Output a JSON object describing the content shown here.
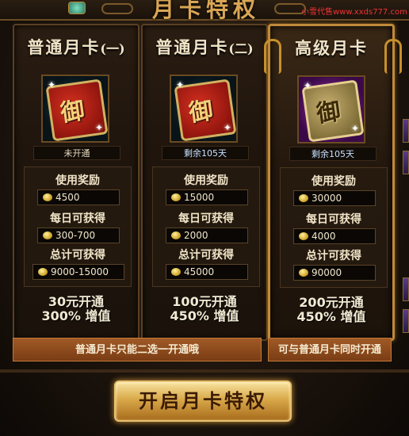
{
  "header": {
    "title": "月卡特权",
    "watermark": "小雪代售www.xxds777.com"
  },
  "cards": [
    {
      "title": "普通月卡",
      "suffix": "(一)",
      "status": "未开通",
      "reward_title": "使用奖励",
      "reward_value": "4500",
      "daily_title": "每日可获得",
      "daily_value": "300-700",
      "total_title": "总计可获得",
      "total_value": "9000-15000",
      "price": "30元开通",
      "bonus": "300% 增值"
    },
    {
      "title": "普通月卡",
      "suffix": "(二)",
      "status": "剩余105天",
      "reward_title": "使用奖励",
      "reward_value": "15000",
      "daily_title": "每日可获得",
      "daily_value": "2000",
      "total_title": "总计可获得",
      "total_value": "45000",
      "price": "100元开通",
      "bonus": "450% 增值"
    },
    {
      "title": "高级月卡",
      "suffix": "",
      "status": "剩余105天",
      "reward_title": "使用奖励",
      "reward_value": "30000",
      "daily_title": "每日可获得",
      "daily_value": "4000",
      "total_title": "总计可获得",
      "total_value": "90000",
      "price": "200元开通",
      "bonus": "450% 增值"
    }
  ],
  "notes": {
    "normal": "普通月卡只能二选一开通哦",
    "premium": "可与普通月卡同时开通"
  },
  "button": {
    "label": "开启月卡特权"
  },
  "icons": {
    "card_art_1": "red-book-icon",
    "card_art_2": "red-book-icon",
    "card_art_3": "gold-book-icon",
    "coin": "gold-coin-icon"
  }
}
